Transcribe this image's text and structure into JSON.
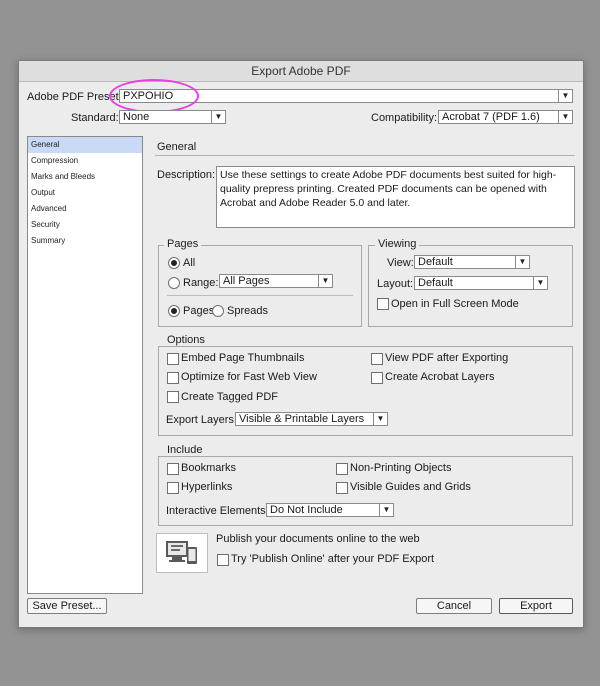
{
  "dialog": {
    "title": "Export Adobe PDF"
  },
  "preset": {
    "label": "Adobe PDF Preset:",
    "value": "PXPOHIO"
  },
  "standard": {
    "label": "Standard:",
    "value": "None"
  },
  "compatibility": {
    "label": "Compatibility:",
    "value": "Acrobat 7 (PDF 1.6)"
  },
  "sidebar": {
    "items": [
      {
        "label": "General"
      },
      {
        "label": "Compression"
      },
      {
        "label": "Marks and Bleeds"
      },
      {
        "label": "Output"
      },
      {
        "label": "Advanced"
      },
      {
        "label": "Security"
      },
      {
        "label": "Summary"
      }
    ]
  },
  "section_title": "General",
  "description": {
    "label": "Description:",
    "text": "Use these settings to create Adobe PDF documents best suited for high-quality prepress printing.  Created PDF documents can be opened with Acrobat and Adobe Reader 5.0 and later."
  },
  "pages": {
    "legend": "Pages",
    "all": "All",
    "range": "Range:",
    "range_value": "All Pages",
    "pages_opt": "Pages",
    "spreads_opt": "Spreads"
  },
  "viewing": {
    "legend": "Viewing",
    "view_label": "View:",
    "view_value": "Default",
    "layout_label": "Layout:",
    "layout_value": "Default",
    "fullscreen": "Open in Full Screen Mode"
  },
  "options": {
    "legend": "Options",
    "embed_thumbnails": "Embed Page Thumbnails",
    "optimize_web": "Optimize for Fast Web View",
    "tagged_pdf": "Create Tagged PDF",
    "view_after": "View PDF after Exporting",
    "acrobat_layers": "Create Acrobat Layers",
    "export_layers_label": "Export Layers:",
    "export_layers_value": "Visible & Printable Layers"
  },
  "include": {
    "legend": "Include",
    "bookmarks": "Bookmarks",
    "hyperlinks": "Hyperlinks",
    "non_printing": "Non-Printing Objects",
    "visible_guides": "Visible Guides and Grids",
    "interactive_label": "Interactive Elements:",
    "interactive_value": "Do Not Include"
  },
  "publish": {
    "heading": "Publish your documents online to the web",
    "try_label": "Try 'Publish Online' after your PDF Export"
  },
  "buttons": {
    "save_preset": "Save Preset...",
    "cancel": "Cancel",
    "export": "Export"
  },
  "colors": {
    "highlight_circle": "#e83fe0",
    "sidebar_selected": "#c9daf6",
    "dialog_bg": "#ececec",
    "backdrop": "#939393"
  },
  "icons": [
    "chevron-down-icon",
    "publish-online-icon"
  ]
}
